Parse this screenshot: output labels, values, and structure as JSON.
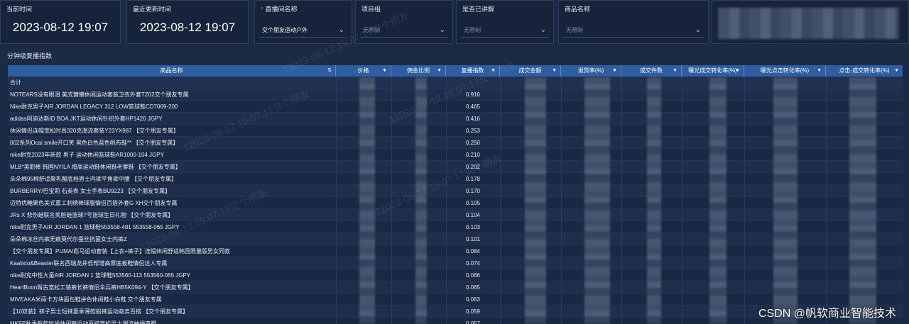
{
  "filters": {
    "current_time": {
      "label": "当前时间",
      "value": "2023-08-12 19:07"
    },
    "last_update": {
      "label": "最近更新时间",
      "value": "2023-08-12 19:07"
    },
    "live_room": {
      "label": "直播间名称",
      "required_mark": "*",
      "value": "交个朋友运动户外"
    },
    "project_group": {
      "label": "项目组",
      "placeholder": "无限制"
    },
    "explained": {
      "label": "是否已讲解",
      "placeholder": "无限制"
    },
    "product_name": {
      "label": "商品名称",
      "placeholder": "无限制"
    }
  },
  "section_title": "分钟级复播指数",
  "table": {
    "headers": [
      "商品名称",
      "价格",
      "佣金比例",
      "复播指数",
      "成交金额",
      "退货率(%)",
      "成交件数",
      "曝光成交转化率(%)",
      "曝光点击转化率(%)",
      "点击-成交转化率(%)"
    ],
    "total_label": "合计",
    "rows": [
      {
        "name": "NOTEARS没有眼泪 美式慵懒休闲运动套装卫衣外套TZ02交个朋友专属",
        "index": "0.916"
      },
      {
        "name": "Nike耐克男子AIR JORDAN LEGACY 312 LOW篮球鞋CD7069-200",
        "index": "0.465"
      },
      {
        "name": "adidas阿迪达斯ID BOA JKT运动休闲针织外套HP1420 JGPY",
        "index": "0.416"
      },
      {
        "name": "休闲情侣连帽宽松时尚320克潮流套装Y23YX987 【交个朋友专属】",
        "index": "0.253"
      },
      {
        "name": "002系列Ocai smile开口笑 黑色白色蓝色帆布鞋** 【交个朋友专属】",
        "index": "0.250"
      },
      {
        "name": "nike耐克2023年新款 男子 运动休闲篮球鞋AR1000-104 JGPY",
        "index": "0.210"
      },
      {
        "name": "MLB*美职棒 韩国NY/LA 增高运动鞋休闲鞋老爹鞋 【交个朋友专属】",
        "index": "0.202"
      },
      {
        "name": "朵朵棉95棉舒适聚乳酸底档男士内裤平角裤中腰 【交个朋友专属】",
        "index": "0.178"
      },
      {
        "name": "BURBERRY/巴宝莉 石英表 女士手表BU9223 【交个朋友专属】",
        "index": "0.170"
      },
      {
        "name": "迈特优糖果色美式重工刺绣棒球服情侣百搭外套G XH交个朋友专属",
        "index": "0.105"
      },
      {
        "name": "JRs X 悲伤蛙联名笑脸蛙篮球7号篮球生日礼物 【交个朋友专属】",
        "index": "0.104"
      },
      {
        "name": "nike耐克男子AIR JORDAN 1 篮球鞋553558-481 553558-065 JGPY",
        "index": "0.103"
      },
      {
        "name": "朵朵棉冰丝内裤无痕莫代尔蚕丝抗菌女士内裤Z",
        "index": "0.101"
      },
      {
        "name": "【交个朋友专属】PUMA/彪马运动套装【上衣+裤子】连帽休闲舒适韩国限量版男女同款",
        "index": "0.084"
      },
      {
        "name": "Kaalixto&Beaster联名西瑞龙井低帮增高厚底板鞋情侣达人专属",
        "index": "0.074"
      },
      {
        "name": "nike耐克中性大童AIR JORDAN 1 篮球鞋553560-113 553560-065 JGPY",
        "index": "0.066"
      },
      {
        "name": "HeartBoon髯古宽松工装裤长裤情侣伞兵裤HB5K094-Y 【交个朋友专属】",
        "index": "0.065"
      },
      {
        "name": "MIVEAKA米蒔卡方块面包鞋拼色休闲鞋小白鞋 交个朋友专属",
        "index": "0.063"
      },
      {
        "name": "【10双装】袜子男士短袜夏季薄款船袜运动商务百搭 【交个朋友专属】",
        "index": "0.059"
      },
      {
        "name": "MKFP秋季新款时尚休闲裤运动百搭宽松男士潮流抽绳束脚",
        "index": "0.057"
      }
    ]
  },
  "watermark_text": "12023-08-12 19:07:17交个朋友",
  "csdn_credit": "CSDN @帆软商业智能技术"
}
